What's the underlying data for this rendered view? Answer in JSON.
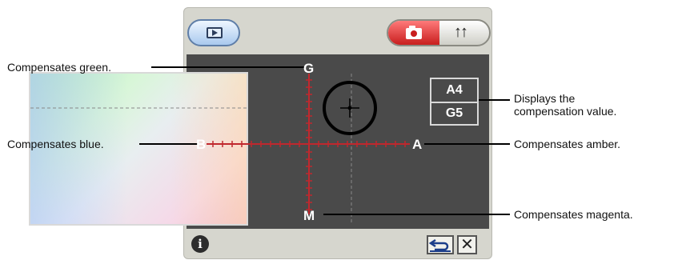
{
  "screen": {
    "buttons": {
      "playback_icon": "playback-icon",
      "shooting_icon": "camera-icon",
      "setup_icon": "wrench-icon",
      "setup_glyph": "↑↑",
      "info_icon": "info-icon",
      "info_glyph": "i",
      "reset_icon": "undo-icon",
      "close_glyph": "✕"
    },
    "axes": {
      "top": "G",
      "bottom": "M",
      "left": "B",
      "right": "A"
    },
    "compensation_value": {
      "line1": "A4",
      "line2": "G5"
    }
  },
  "callouts": {
    "green": "Compensates green.",
    "blue": "Compensates blue.",
    "display_line1": "Displays the",
    "display_line2": "compensation value.",
    "amber": "Compensates amber.",
    "magenta": "Compensates magenta."
  },
  "colors": {
    "panel": "#4a4a4a",
    "frame": "#d6d6ce",
    "axis_red": "#c0282e",
    "shooting_mode_red": "#c81e1e"
  }
}
